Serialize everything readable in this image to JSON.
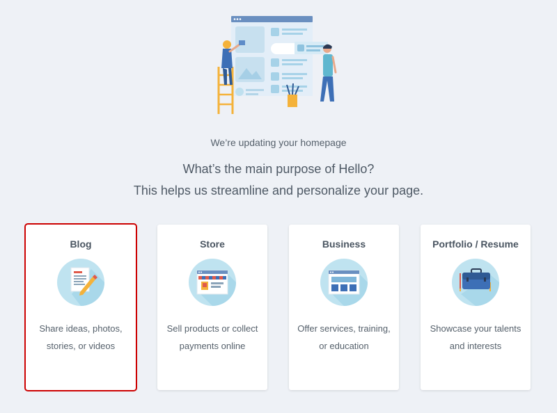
{
  "header": {
    "kicker": "We’re updating your homepage",
    "headline": "What’s the main purpose of Hello?",
    "subline": "This helps us streamline and personalize your page."
  },
  "cards": [
    {
      "title": "Blog",
      "description": "Share ideas, photos, stories, or videos",
      "icon": "blog-document-pencil-icon",
      "selected": true
    },
    {
      "title": "Store",
      "description": "Sell products or collect payments online",
      "icon": "storefront-icon",
      "selected": false
    },
    {
      "title": "Business",
      "description": "Offer services, training, or education",
      "icon": "business-window-icon",
      "selected": false
    },
    {
      "title": "Portfolio / Resume",
      "description": "Showcase your talents and interests",
      "icon": "briefcase-icon",
      "selected": false
    }
  ],
  "colors": {
    "background": "#eef1f6",
    "selection_border": "#cc0000",
    "icon_circle": "#bfe3f0",
    "accent_blue": "#3d6fb6",
    "accent_yellow": "#f4b23a"
  }
}
